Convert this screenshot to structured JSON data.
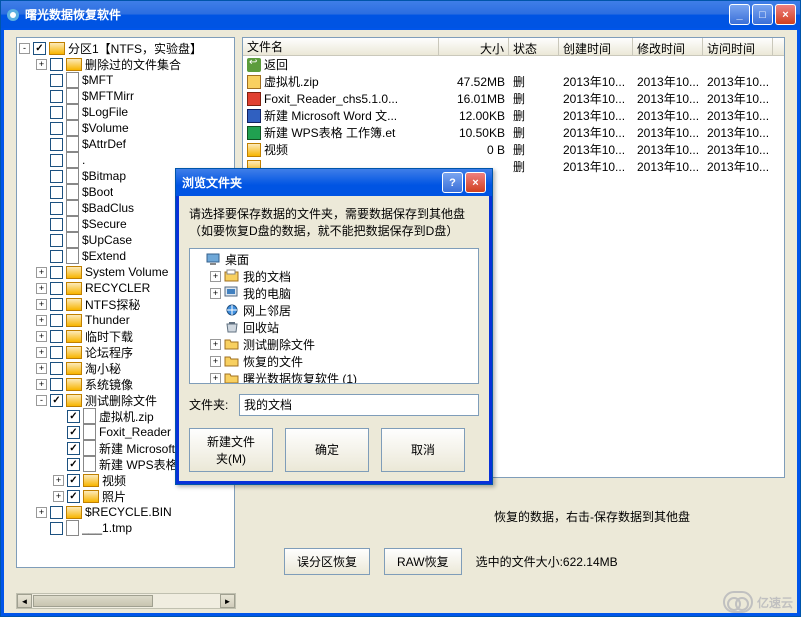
{
  "main": {
    "title": "曙光数据恢复软件",
    "win_buttons": {
      "min": "_",
      "max": "□",
      "close": "×"
    }
  },
  "tree": {
    "root": "分区1【NTFS，实验盘】",
    "items": [
      "删除过的文件集合",
      "$MFT",
      "$MFTMirr",
      "$LogFile",
      "$Volume",
      "$AttrDef",
      ".",
      "$Bitmap",
      "$Boot",
      "$BadClus",
      "$Secure",
      "$UpCase",
      "$Extend",
      "System Volume",
      "RECYCLER",
      "NTFS探秘",
      "Thunder",
      "临时下载",
      "论坛程序",
      "淘小秘",
      "系统镜像",
      "测试删除文件"
    ],
    "test_children": [
      "虚拟机.zip",
      "Foxit_Reader",
      "新建 Microsoft",
      "新建 WPS表格",
      "视频",
      "照片"
    ],
    "recycle": "$RECYCLE.BIN",
    "tmp": "___1.tmp"
  },
  "list": {
    "headers": {
      "name": "文件名",
      "size": "大小",
      "status": "状态",
      "created": "创建时间",
      "modified": "修改时间",
      "accessed": "访问时间"
    },
    "back": "返回",
    "rows": [
      {
        "name": "虚拟机.zip",
        "size": "47.52MB",
        "status": "删",
        "created": "2013年10...",
        "modified": "2013年10...",
        "accessed": "2013年10..."
      },
      {
        "name": "Foxit_Reader_chs5.1.0...",
        "size": "16.01MB",
        "status": "删",
        "created": "2013年10...",
        "modified": "2013年10...",
        "accessed": "2013年10..."
      },
      {
        "name": "新建 Microsoft Word 文...",
        "size": "12.00KB",
        "status": "删",
        "created": "2013年10...",
        "modified": "2013年10...",
        "accessed": "2013年10..."
      },
      {
        "name": "新建 WPS表格 工作簿.et",
        "size": "10.50KB",
        "status": "删",
        "created": "2013年10...",
        "modified": "2013年10...",
        "accessed": "2013年10..."
      },
      {
        "name": "视频",
        "size": "0 B",
        "status": "删",
        "created": "2013年10...",
        "modified": "2013年10...",
        "accessed": "2013年10..."
      },
      {
        "name": "",
        "size": "",
        "status": "删",
        "created": "2013年10...",
        "modified": "2013年10...",
        "accessed": "2013年10..."
      }
    ]
  },
  "bottom": {
    "hint_suffix": "恢复的数据，右击-保存数据到其他盘",
    "btn_scan": "误分区恢复",
    "btn_raw": "RAW恢复",
    "selected_label": "选中的文件大小:",
    "selected_size": "622.14MB"
  },
  "dialog": {
    "title": "浏览文件夹",
    "help": "?",
    "close": "×",
    "msg_line1": "请选择要保存数据的文件夹，需要数据保存到其他盘",
    "msg_line2": "（如要恢复D盘的数据，就不能把数据保存到D盘）",
    "tree": [
      {
        "label": "桌面",
        "expand": "",
        "indent": 0,
        "icon": "desktop"
      },
      {
        "label": "我的文档",
        "expand": "+",
        "indent": 1,
        "icon": "folder-docs"
      },
      {
        "label": "我的电脑",
        "expand": "+",
        "indent": 1,
        "icon": "computer"
      },
      {
        "label": "网上邻居",
        "expand": "",
        "indent": 1,
        "icon": "network"
      },
      {
        "label": "回收站",
        "expand": "",
        "indent": 1,
        "icon": "recycle"
      },
      {
        "label": "测试删除文件",
        "expand": "+",
        "indent": 1,
        "icon": "folder"
      },
      {
        "label": "恢复的文件",
        "expand": "+",
        "indent": 1,
        "icon": "folder"
      },
      {
        "label": "曙光数据恢复软件 (1)",
        "expand": "+",
        "indent": 1,
        "icon": "folder"
      }
    ],
    "folder_label": "文件夹:",
    "folder_value": "我的文档",
    "btn_new": "新建文件夹(M)",
    "btn_ok": "确定",
    "btn_cancel": "取消"
  },
  "watermark": "亿速云"
}
